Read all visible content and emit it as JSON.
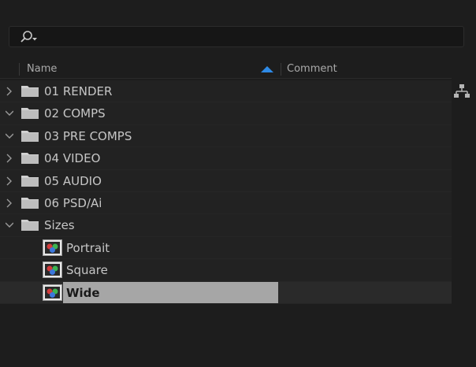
{
  "columns": {
    "name": "Name",
    "comment": "Comment"
  },
  "items": [
    {
      "label": "01 RENDER",
      "type": "folder",
      "expanded": false
    },
    {
      "label": "02 COMPS",
      "type": "folder",
      "expanded": true
    },
    {
      "label": "03 PRE COMPS",
      "type": "folder",
      "expanded": true
    },
    {
      "label": "04 VIDEO",
      "type": "folder",
      "expanded": false
    },
    {
      "label": "05 AUDIO",
      "type": "folder",
      "expanded": false
    },
    {
      "label": "06 PSD/Ai",
      "type": "folder",
      "expanded": false
    },
    {
      "label": "Sizes",
      "type": "folder",
      "expanded": true
    },
    {
      "label": "Portrait",
      "type": "composition"
    },
    {
      "label": "Square",
      "type": "composition"
    },
    {
      "label": "Wide",
      "type": "composition",
      "selected": true
    }
  ],
  "colors": {
    "background": "#1d1d1d",
    "sort_accent": "#2e8ae6",
    "selection": "#a6a6a6"
  },
  "icons": [
    "search-icon",
    "sort-ascending-icon",
    "chevron-right-icon",
    "chevron-down-icon",
    "folder-icon",
    "composition-icon",
    "flowchart-icon"
  ]
}
